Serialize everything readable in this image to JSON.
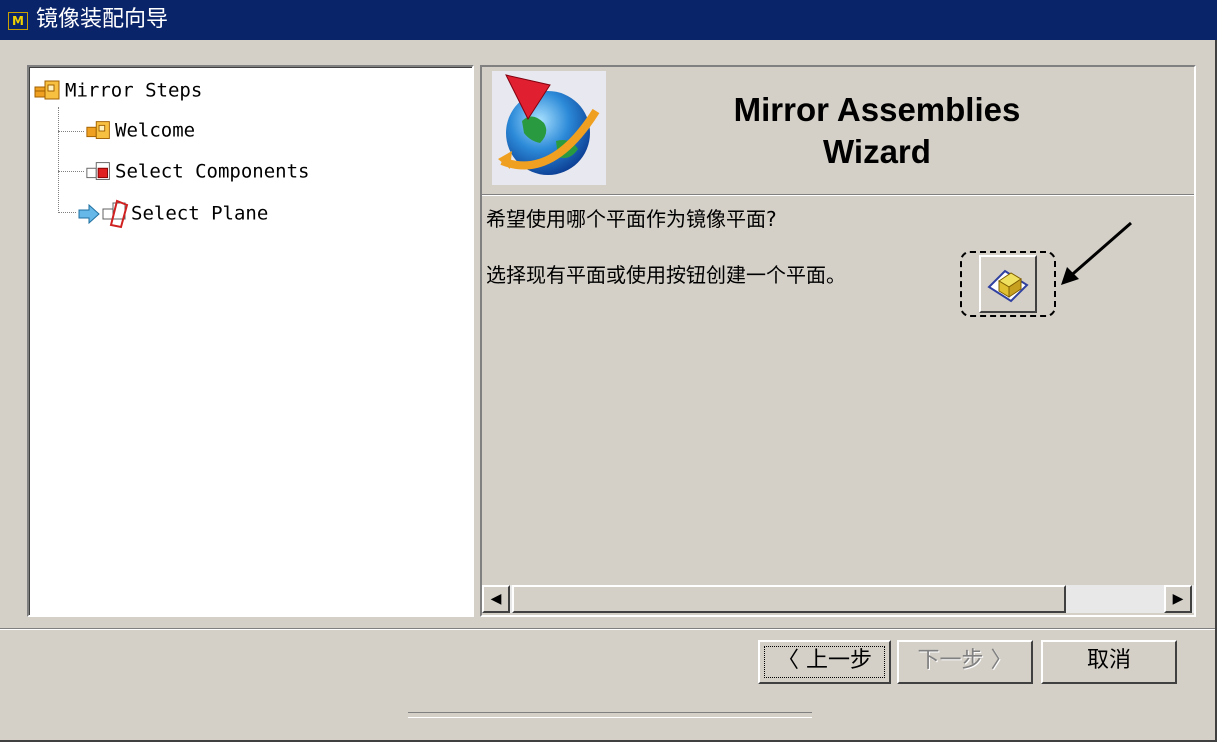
{
  "window": {
    "title": "镜像装配向导",
    "title_icon_glyph": "M"
  },
  "tree": {
    "root": {
      "label": "Mirror Steps",
      "icon": "assembly-icon"
    },
    "items": [
      {
        "label": "Welcome",
        "icon": "assembly-icon",
        "state": "done"
      },
      {
        "label": "Select Components",
        "icon": "assembly-red-icon",
        "state": "done"
      },
      {
        "label": "Select Plane",
        "icon": "plane-assembly-icon",
        "state": "current",
        "marker": "current-step-arrow-icon"
      }
    ]
  },
  "header": {
    "title_line1": "Mirror Assemblies",
    "title_line2": "Wizard",
    "logo": "ug-globe-logo-icon"
  },
  "content": {
    "question": "希望使用哪个平面作为镜像平面?",
    "instruction": "选择现有平面或使用按钮创建一个平面。",
    "plane_button_icon": "create-plane-icon"
  },
  "scrollbar": {
    "left_arrow": "◀",
    "right_arrow": "▶"
  },
  "footer": {
    "back_label": "〈 上一步",
    "next_label": "下一步 〉",
    "cancel_label": "取消"
  },
  "colors": {
    "titlebar": "#0a246a",
    "face": "#d4d0c8",
    "current_arrow": "#66b8e8"
  }
}
